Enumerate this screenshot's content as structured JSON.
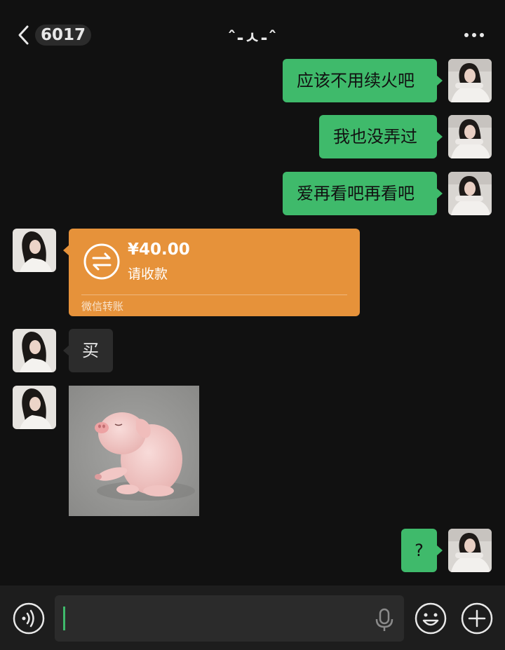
{
  "header": {
    "unread_count": "6017",
    "title": "ˆ-ㅅ-ˆ"
  },
  "messages": [
    {
      "side": "right",
      "type": "text",
      "text": "应该不用续火吧"
    },
    {
      "side": "right",
      "type": "text",
      "text": "我也没弄过"
    },
    {
      "side": "right",
      "type": "text",
      "text": "爱再看吧再看吧"
    },
    {
      "side": "left",
      "type": "transfer",
      "amount": "¥40.00",
      "status": "请收款",
      "footer": "微信转账"
    },
    {
      "side": "left",
      "type": "text",
      "text": "买"
    },
    {
      "side": "left",
      "type": "image",
      "description": "pig-sticker"
    },
    {
      "side": "right",
      "type": "text",
      "text": "?"
    }
  ],
  "colors": {
    "background": "#111111",
    "sent_bubble": "#3fba6b",
    "received_bubble": "#2c2c2c",
    "transfer_card": "#e6923a",
    "input_bar": "#1d1d1d"
  },
  "icons": {
    "back": "chevron-left-icon",
    "more": "more-dots-icon",
    "voice": "voice-mode-icon",
    "mic": "microphone-icon",
    "emoji": "emoji-icon",
    "plus": "plus-icon",
    "transfer": "transfer-arrows-icon"
  }
}
